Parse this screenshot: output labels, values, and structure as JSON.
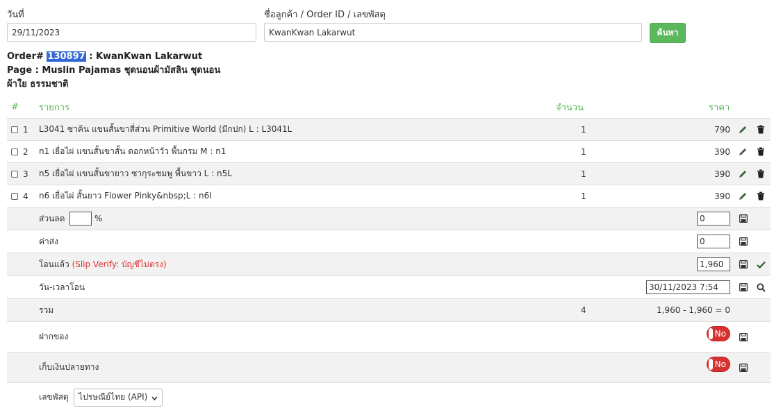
{
  "search": {
    "date_label": "วันที่",
    "date_value": "29/11/2023",
    "customer_label": "ชื่อลูกค้า / Order ID / เลขพัสดุ",
    "customer_value": "KwanKwan Lakarwut",
    "search_button": "ค้นหา"
  },
  "order": {
    "prefix": "Order# ",
    "id": "130897",
    "customer": " : KwanKwan Lakarwut",
    "page_line": "Page : Muslin Pajamas ชุดนอนผ้ามัสลิน ชุดนอนผ้าใย ธรรมชาติ"
  },
  "table": {
    "headers": {
      "num": "#",
      "item": "รายการ",
      "qty": "จำนวน",
      "price": "ราคา"
    },
    "items": [
      {
        "num": "1",
        "name": "L3041 ซาคิน แขนสั้นขาสี่ส่วน Primitive World (มีกปก) L : L3041L",
        "qty": "1",
        "price": "790"
      },
      {
        "num": "2",
        "name": "n1 เยื่อไผ่ แขนสั้นขาสั้น ดอกหน้าวัว พื้นกรม M : n1",
        "qty": "1",
        "price": "390"
      },
      {
        "num": "3",
        "name": "n5 เยื่อไผ่ แขนสั้นขายาว ซากุระชมพู พื้นขาว L : n5L",
        "qty": "1",
        "price": "390"
      },
      {
        "num": "4",
        "name": "n6 เยื่อไผ่ สั้นยาว Flower Pinky&nbsp;L : n6l",
        "qty": "1",
        "price": "390"
      }
    ],
    "discount": {
      "label": "ส่วนลด",
      "percent_value": "",
      "percent_sign": "%",
      "value": "0"
    },
    "shipping": {
      "label": "ค่าส่ง",
      "value": "0"
    },
    "paid": {
      "label": "โอนแล้ว",
      "note": "(Slip Verify: บัญชีไม่ตรง)",
      "value": "1,960"
    },
    "transfer_time": {
      "label": "วัน-เวลาโอน",
      "value": "30/11/2023 7:54"
    },
    "total": {
      "label": "รวม",
      "qty": "4",
      "value": "1,960 - 1,960 = 0"
    },
    "deposit": {
      "label": "ฝากของ",
      "toggle": "No"
    },
    "cod": {
      "label": "เก็บเงินปลายทาง",
      "toggle": "No"
    },
    "tracking": {
      "label": "เลขพัสดุ",
      "carrier": "ไปรษณีย์ไทย (API)"
    }
  },
  "colors": {
    "accent": "#5cb85c",
    "danger": "#d9312f",
    "highlight": "#3369d6"
  }
}
